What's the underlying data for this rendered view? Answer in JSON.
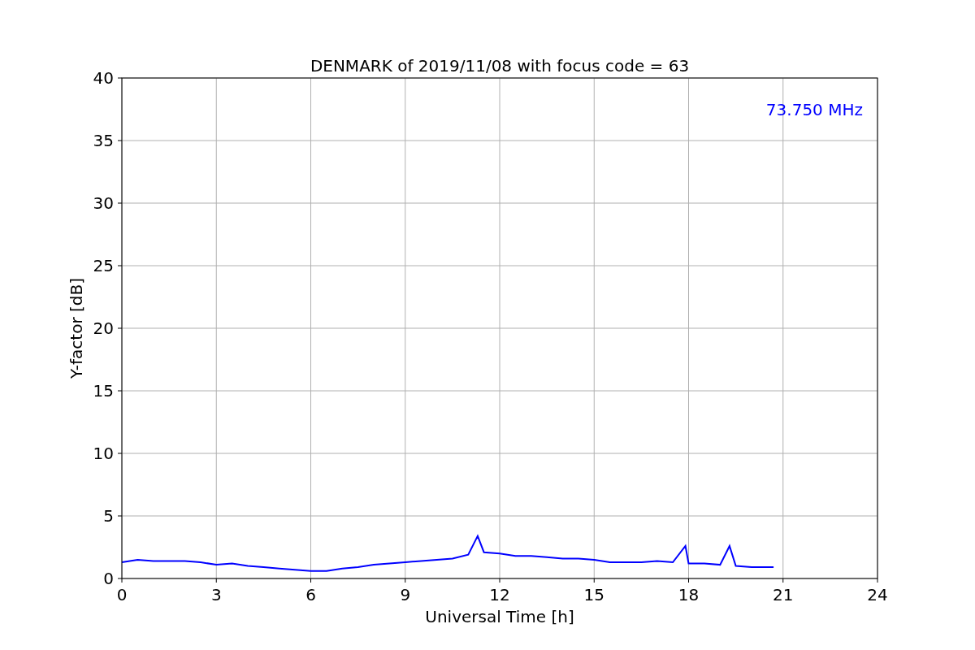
{
  "chart_data": {
    "type": "line",
    "title": "DENMARK of 2019/11/08 with focus code = 63",
    "xlabel": "Universal Time [h]",
    "ylabel": "Y-factor [dB]",
    "x": [
      0,
      0.5,
      1,
      1.5,
      2,
      2.5,
      3,
      3.5,
      4,
      4.5,
      5,
      5.5,
      6,
      6.5,
      7,
      7.5,
      8,
      8.5,
      9,
      9.5,
      10,
      10.5,
      11,
      11.3,
      11.5,
      12,
      12.5,
      13,
      13.5,
      14,
      14.5,
      15,
      15.5,
      16,
      16.5,
      17,
      17.5,
      17.9,
      18,
      18.5,
      19,
      19.3,
      19.5,
      20,
      20.5,
      20.7
    ],
    "series": [
      {
        "color": "#0000ff",
        "values": [
          1.3,
          1.5,
          1.4,
          1.4,
          1.4,
          1.3,
          1.1,
          1.2,
          1.0,
          0.9,
          0.8,
          0.7,
          0.6,
          0.6,
          0.8,
          0.9,
          1.1,
          1.2,
          1.3,
          1.4,
          1.5,
          1.6,
          1.9,
          3.4,
          2.1,
          2.0,
          1.8,
          1.8,
          1.7,
          1.6,
          1.6,
          1.5,
          1.3,
          1.3,
          1.3,
          1.4,
          1.3,
          2.6,
          1.2,
          1.2,
          1.1,
          2.6,
          1.0,
          0.9,
          0.9,
          0.9
        ]
      }
    ],
    "xlim": [
      0,
      24
    ],
    "ylim": [
      0,
      40
    ],
    "xticks": [
      0,
      3,
      6,
      9,
      12,
      15,
      18,
      21,
      24
    ],
    "yticks": [
      0,
      5,
      10,
      15,
      20,
      25,
      30,
      35,
      40
    ],
    "grid": true,
    "annotations": [
      {
        "text": "73.750 MHz"
      }
    ]
  }
}
